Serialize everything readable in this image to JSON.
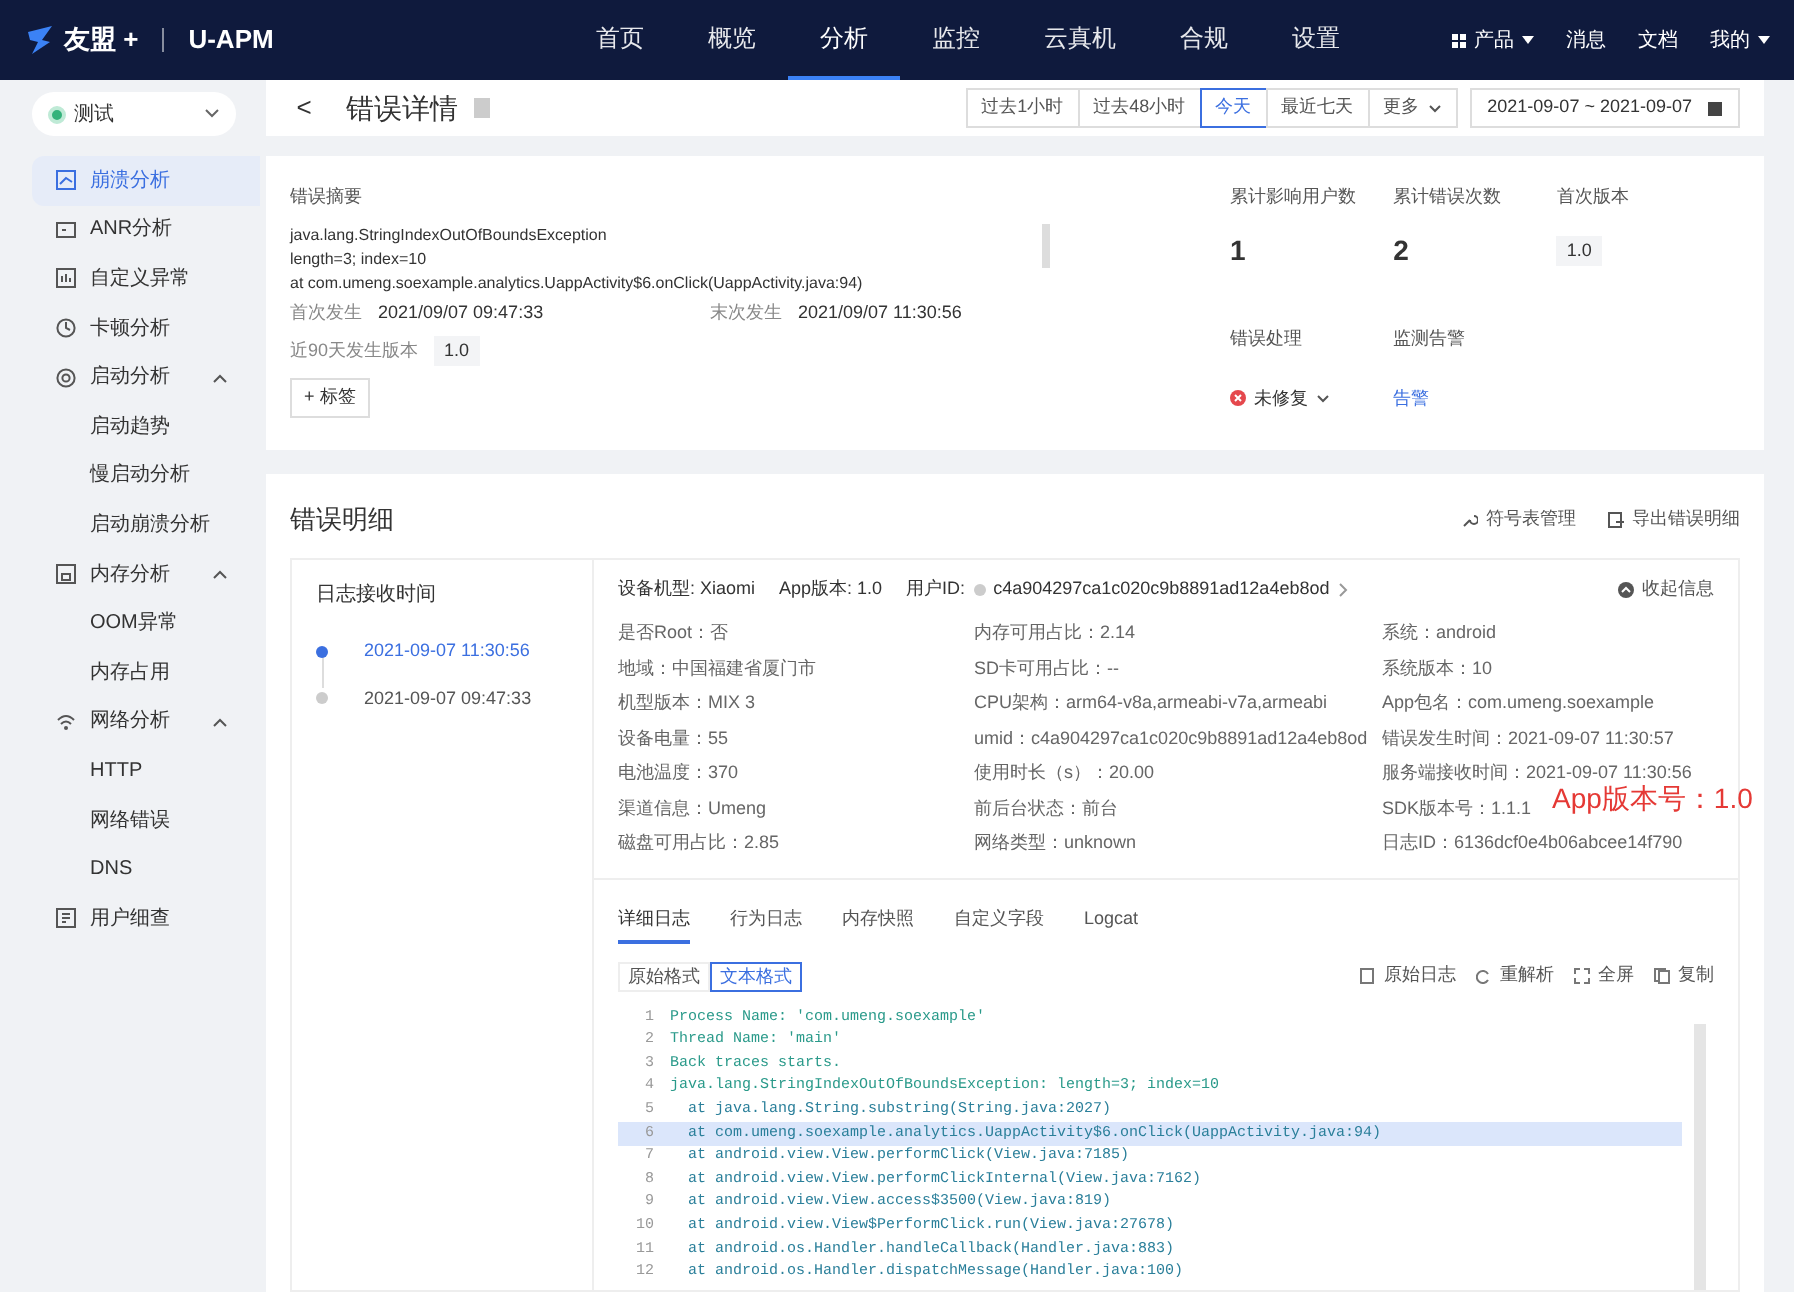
{
  "topbar": {
    "logo": "友盟 +",
    "product": "U-APM",
    "menu": [
      {
        "label": "首页",
        "selected": false
      },
      {
        "label": "概览",
        "selected": false
      },
      {
        "label": "分析",
        "selected": true
      },
      {
        "label": "监控",
        "selected": false
      },
      {
        "label": "云真机",
        "selected": false
      },
      {
        "label": "合规",
        "selected": false
      },
      {
        "label": "设置",
        "selected": false
      }
    ],
    "right": [
      {
        "label": "产品",
        "kind": "grid-dropdown"
      },
      {
        "label": "消息",
        "kind": "plain"
      },
      {
        "label": "文档",
        "kind": "plain"
      },
      {
        "label": "我的",
        "kind": "dropdown"
      }
    ]
  },
  "sidebar": {
    "app_select": "测试",
    "items": [
      {
        "label": "崩溃分析",
        "selected": true
      },
      {
        "label": "ANR分析",
        "selected": false
      },
      {
        "label": "自定义异常",
        "selected": false
      },
      {
        "label": "卡顿分析",
        "selected": false
      },
      {
        "label": "启动分析",
        "selected": false,
        "expanded": true,
        "children": [
          {
            "label": "启动趋势",
            "selected": false
          },
          {
            "label": "慢启动分析",
            "selected": false
          },
          {
            "label": "启动崩溃分析",
            "selected": false
          }
        ]
      },
      {
        "label": "内存分析",
        "selected": false,
        "expanded": true,
        "children": [
          {
            "label": "OOM异常",
            "selected": false
          },
          {
            "label": "内存占用",
            "selected": false
          }
        ]
      },
      {
        "label": "网络分析",
        "selected": false,
        "expanded": true,
        "children": [
          {
            "label": "HTTP",
            "selected": false
          },
          {
            "label": "网络错误",
            "selected": false
          },
          {
            "label": "DNS",
            "selected": false
          }
        ]
      },
      {
        "label": "用户细查",
        "selected": false
      }
    ]
  },
  "header": {
    "back": "<",
    "title": "错误详情",
    "ranges": [
      {
        "label": "过去1小时",
        "selected": false
      },
      {
        "label": "过去48小时",
        "selected": false
      },
      {
        "label": "今天",
        "selected": true
      },
      {
        "label": "最近七天",
        "selected": false
      },
      {
        "label": "更多",
        "selected": false
      }
    ],
    "date_range": "2021-09-07 ~ 2021-09-07"
  },
  "summary": {
    "label": "错误摘要",
    "lines": [
      "java.lang.StringIndexOutOfBoundsException",
      "length=3; index=10",
      "at com.umeng.soexample.analytics.UappActivity$6.onClick(UappActivity.java:94)"
    ],
    "first_label": "首次发生",
    "first_value": "2021/09/07 09:47:33",
    "last_label": "末次发生",
    "last_value": "2021/09/07 11:30:56",
    "versions_label": "近90天发生版本",
    "versions_value": "1.0",
    "tag_button": "+ 标签",
    "stats": [
      {
        "label": "累计影响用户数",
        "value": "1",
        "kind": "number"
      },
      {
        "label": "累计错误次数",
        "value": "2",
        "kind": "number"
      },
      {
        "label": "首次版本",
        "value": "1.0",
        "kind": "badge"
      }
    ],
    "handling_label": "错误处理",
    "handling_status": "未修复",
    "alert_label": "监测告警",
    "alert_link": "告警"
  },
  "details": {
    "title": "错误明细",
    "actions": [
      "符号表管理",
      "导出错误明细"
    ],
    "timeline_label": "日志接收时间",
    "timeline": [
      {
        "time": "2021-09-07 11:30:56",
        "selected": true
      },
      {
        "time": "2021-09-07 09:47:33",
        "selected": false
      }
    ],
    "device": {
      "model": "设备机型: Xiaomi",
      "app_version": "App版本: 1.0",
      "user_label": "用户ID:",
      "user_id": "c4a904297ca1c020c9b8891ad12a4eb8od",
      "collapse": "收起信息"
    },
    "info_fields": [
      "是否Root：否",
      "内存可用占比：2.14",
      "系统：android",
      "地域：中国福建省厦门市",
      "SD卡可用占比：--",
      "系统版本：10",
      "机型版本：MIX 3",
      "CPU架构：arm64-v8a,armeabi-v7a,armeabi",
      "App包名：com.umeng.soexample",
      "设备电量：55",
      "umid：c4a904297ca1c020c9b8891ad12a4eb8od",
      "错误发生时间：2021-09-07 11:30:57",
      "电池温度：370",
      "使用时长（s）：20.00",
      "服务端接收时间：2021-09-07 11:30:56",
      "渠道信息：Umeng",
      "前后台状态：前台",
      "SDK版本号：1.1.1",
      "磁盘可用占比：2.85",
      "网络类型：unknown",
      "日志ID：6136dcf0e4b06abcee14f790"
    ],
    "annotation": "App版本号：1.0",
    "tabs": [
      {
        "label": "详细日志",
        "selected": true
      },
      {
        "label": "行为日志",
        "selected": false
      },
      {
        "label": "内存快照",
        "selected": false
      },
      {
        "label": "自定义字段",
        "selected": false
      },
      {
        "label": "Logcat",
        "selected": false
      }
    ],
    "formats": [
      {
        "label": "原始格式",
        "selected": false
      },
      {
        "label": "文本格式",
        "selected": true
      }
    ],
    "tools": [
      "原始日志",
      "重解析",
      "全屏",
      "复制"
    ],
    "code": [
      {
        "no": "1",
        "text": "Process Name: 'com.umeng.soexample'",
        "kind": "head",
        "selected": false
      },
      {
        "no": "2",
        "text": "Thread Name: 'main'",
        "kind": "head",
        "selected": false
      },
      {
        "no": "3",
        "text": "Back traces starts.",
        "kind": "head",
        "selected": false
      },
      {
        "no": "4",
        "text": "java.lang.StringIndexOutOfBoundsException: length=3; index=10",
        "kind": "head",
        "selected": false
      },
      {
        "no": "5",
        "text": "at java.lang.String.substring(String.java:2027)",
        "kind": "frame",
        "selected": false
      },
      {
        "no": "6",
        "text": "at com.umeng.soexample.analytics.UappActivity$6.onClick(UappActivity.java:94)",
        "kind": "frame",
        "selected": true
      },
      {
        "no": "7",
        "text": "at android.view.View.performClick(View.java:7185)",
        "kind": "frame",
        "selected": false
      },
      {
        "no": "8",
        "text": "at android.view.View.performClickInternal(View.java:7162)",
        "kind": "frame",
        "selected": false
      },
      {
        "no": "9",
        "text": "at android.view.View.access$3500(View.java:819)",
        "kind": "frame",
        "selected": false
      },
      {
        "no": "10",
        "text": "at android.view.View$PerformClick.run(View.java:27678)",
        "kind": "frame",
        "selected": false
      },
      {
        "no": "11",
        "text": "at android.os.Handler.handleCallback(Handler.java:883)",
        "kind": "frame",
        "selected": false
      },
      {
        "no": "12",
        "text": "at android.os.Handler.dispatchMessage(Handler.java:100)",
        "kind": "frame",
        "selected": false
      }
    ]
  }
}
